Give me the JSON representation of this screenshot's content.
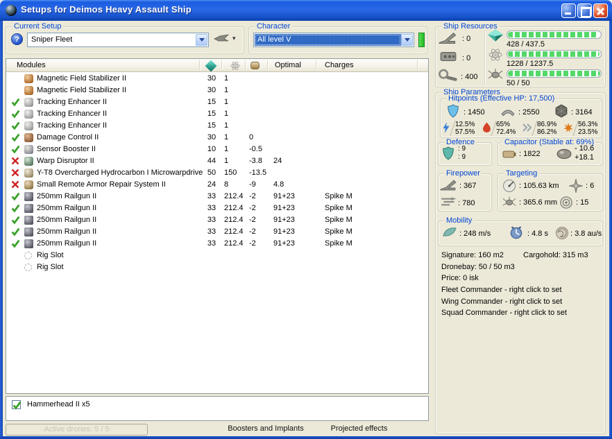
{
  "window": {
    "title": "Setups for Deimos Heavy Assault Ship"
  },
  "glyphs": {
    "help": "?",
    "dropdown_caret": "▾"
  },
  "colors": {
    "group_label_blue": "#0046D5",
    "bar_green": "#54d868",
    "titlebar_blue": "#1b5ce0"
  },
  "current_setup": {
    "label": "Current Setup",
    "value": "Sniper Fleet"
  },
  "character": {
    "label": "Character",
    "value": "All level V"
  },
  "modules": {
    "header": {
      "name": "Modules",
      "cpu_icon": "cpu-icon",
      "powergrid_icon": "powergrid-icon",
      "capacitor_icon": "capacitor-icon",
      "optimal": "Optimal",
      "charges": "Charges"
    },
    "rows": [
      {
        "status": "",
        "icon": "magstab",
        "name": "Magnetic Field Stabilizer II",
        "cpu": "30",
        "pg": "1"
      },
      {
        "status": "",
        "icon": "magstab",
        "name": "Magnetic Field Stabilizer II",
        "cpu": "30",
        "pg": "1"
      },
      {
        "status": "ok",
        "icon": "tracking-enhancer",
        "name": "Tracking Enhancer II",
        "cpu": "15",
        "pg": "1"
      },
      {
        "status": "ok",
        "icon": "tracking-enhancer",
        "name": "Tracking Enhancer II",
        "cpu": "15",
        "pg": "1"
      },
      {
        "status": "ok",
        "icon": "tracking-enhancer",
        "name": "Tracking Enhancer II",
        "cpu": "15",
        "pg": "1"
      },
      {
        "status": "ok",
        "icon": "damage-control",
        "name": "Damage Control II",
        "cpu": "30",
        "pg": "1",
        "cap": "0"
      },
      {
        "status": "ok",
        "icon": "sensor-booster",
        "name": "Sensor Booster II",
        "cpu": "10",
        "pg": "1",
        "cap": "-0.5"
      },
      {
        "status": "err",
        "icon": "warp-disruptor",
        "name": "Warp Disruptor II",
        "cpu": "44",
        "pg": "1",
        "cap": "-3.8",
        "optimal": "24"
      },
      {
        "status": "err",
        "icon": "microwarpdrive",
        "name": "Y-T8 Overcharged Hydrocarbon I Microwarpdrive",
        "cpu": "50",
        "pg": "150",
        "cap": "-13.5"
      },
      {
        "status": "err",
        "icon": "remote-armor-repairer",
        "name": "Small Remote Armor Repair System II",
        "cpu": "24",
        "pg": "8",
        "cap": "-9",
        "optimal": "4.8"
      },
      {
        "status": "ok",
        "icon": "railgun",
        "name": "250mm Railgun II",
        "cpu": "33",
        "pg": "212.4",
        "cap": "-2",
        "optimal": "91+23",
        "charges": "Spike M"
      },
      {
        "status": "ok",
        "icon": "railgun",
        "name": "250mm Railgun II",
        "cpu": "33",
        "pg": "212.4",
        "cap": "-2",
        "optimal": "91+23",
        "charges": "Spike M"
      },
      {
        "status": "ok",
        "icon": "railgun",
        "name": "250mm Railgun II",
        "cpu": "33",
        "pg": "212.4",
        "cap": "-2",
        "optimal": "91+23",
        "charges": "Spike M"
      },
      {
        "status": "ok",
        "icon": "railgun",
        "name": "250mm Railgun II",
        "cpu": "33",
        "pg": "212.4",
        "cap": "-2",
        "optimal": "91+23",
        "charges": "Spike M"
      },
      {
        "status": "ok",
        "icon": "railgun",
        "name": "250mm Railgun II",
        "cpu": "33",
        "pg": "212.4",
        "cap": "-2",
        "optimal": "91+23",
        "charges": "Spike M"
      },
      {
        "status": "",
        "icon": "rig-slot",
        "name": "Rig Slot"
      },
      {
        "status": "",
        "icon": "rig-slot",
        "name": "Rig Slot"
      }
    ]
  },
  "drones": {
    "items": [
      {
        "checked": true,
        "label": "Hammerhead II x5"
      }
    ]
  },
  "tabs": [
    {
      "label": "Active drones: 5 / 5",
      "active": true
    },
    {
      "label": "Boosters and Implants",
      "active": false
    },
    {
      "label": "Projected effects",
      "active": false
    }
  ],
  "ship_resources": {
    "label": "Ship Resources",
    "turrets": ": 0",
    "launchers": ": 0",
    "calibration": ": 400",
    "cpu": "428 / 437.5",
    "powergrid": "1228 / 1237.5",
    "drone_bandwidth": "50 / 50"
  },
  "ship_parameters": {
    "label": "Ship Parameters",
    "hitpoints": {
      "label": "Hitpoints (Effective HP: 17,500)",
      "shield": ": 1450",
      "armor": ": 2550",
      "structure": ": 3164",
      "resists": [
        {
          "name": "em",
          "shield": "12.5%",
          "armor": "57.5%"
        },
        {
          "name": "thermal",
          "shield": "65%",
          "armor": "72.4%"
        },
        {
          "name": "kinetic",
          "shield": "86.9%",
          "armor": "86.2%"
        },
        {
          "name": "explosive",
          "shield": "56.3%",
          "armor": "23.5%"
        }
      ]
    },
    "defence": {
      "label": "Defence",
      "value1": ": 9",
      "value2": ": 9"
    },
    "capacitor": {
      "label": "Capacitor (Stable at: 69%)",
      "amount": ": 1822",
      "drain": "- 10.6",
      "recharge": "+18.1"
    },
    "firepower": {
      "label": "Firepower",
      "dps": ": 367",
      "volley": ": 780"
    },
    "targeting": {
      "label": "Targeting",
      "range": ": 105.63 km",
      "max_targets": ": 6",
      "scan_resolution": ": 365.6 mm",
      "sensor_strength": ": 15"
    },
    "mobility": {
      "label": "Mobility",
      "speed": ": 248 m/s",
      "align_time": ": 4.8 s",
      "warp_speed": ": 3.8 au/s"
    },
    "info": {
      "signature": "Signature: 160 m2",
      "cargohold": "Cargohold: 315 m3",
      "dronebay": "Dronebay: 50 / 50 m3",
      "price": "Price: 0 isk",
      "fleet_commander": "Fleet Commander - right click to set",
      "wing_commander": "Wing Commander - right click to set",
      "squad_commander": "Squad Commander - right click to set"
    }
  }
}
